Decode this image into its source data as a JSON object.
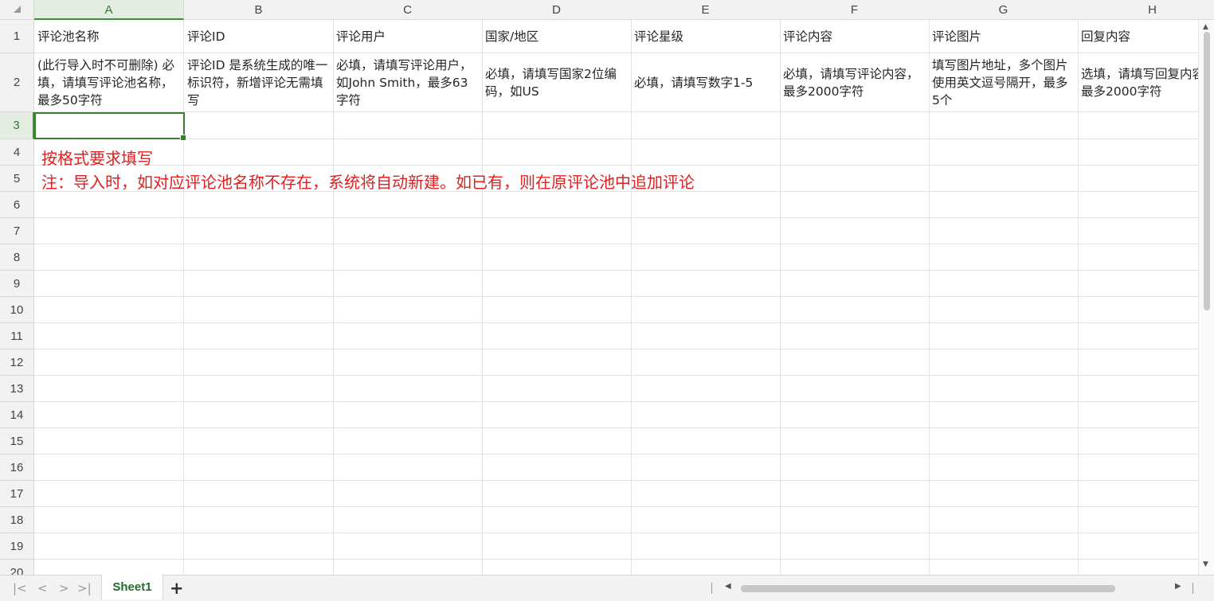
{
  "app": {
    "title": "Spreadsheet"
  },
  "columns": [
    "A",
    "B",
    "C",
    "D",
    "E",
    "F",
    "G",
    "H"
  ],
  "rows": [
    "1",
    "2",
    "3",
    "4",
    "5",
    "6",
    "7",
    "8",
    "9",
    "10",
    "11",
    "12",
    "13",
    "14",
    "15",
    "16",
    "17",
    "18",
    "19",
    "20"
  ],
  "header_row": [
    "评论池名称",
    "评论ID",
    "评论用户",
    "国家/地区",
    "评论星级",
    "评论内容",
    "评论图片",
    "回复内容"
  ],
  "hint_row": [
    "(此行导入时不可删除) 必填，请填写评论池名称，最多50字符",
    "评论ID 是系统生成的唯一标识符，新增评论无需填写",
    "必填，请填写评论用户，如John Smith，最多63字符",
    "必填，请填写国家2位编码，如US",
    "必填，请填写数字1-5",
    "必填，请填写评论内容，最多2000字符",
    "填写图片地址，多个图片使用英文逗号隔开，最多5个",
    "选填，请填写回复内容，最多2000字符"
  ],
  "notes": {
    "line1": "按格式要求填写",
    "line2": "注：导入时，如对应评论池名称不存在，系统将自动新建。如已有，则在原评论池中追加评论"
  },
  "selection": {
    "cell": "A3"
  },
  "sheet_tabs": [
    {
      "label": "Sheet1",
      "active": true
    }
  ],
  "colors": {
    "accent": "#3b7d2e",
    "note_text": "#e02020",
    "tab_text": "#1b6e2a"
  },
  "icons": {
    "first": "first-sheet-icon",
    "prev": "prev-sheet-icon",
    "next": "next-sheet-icon",
    "last": "last-sheet-icon",
    "add": "add-sheet-icon"
  }
}
